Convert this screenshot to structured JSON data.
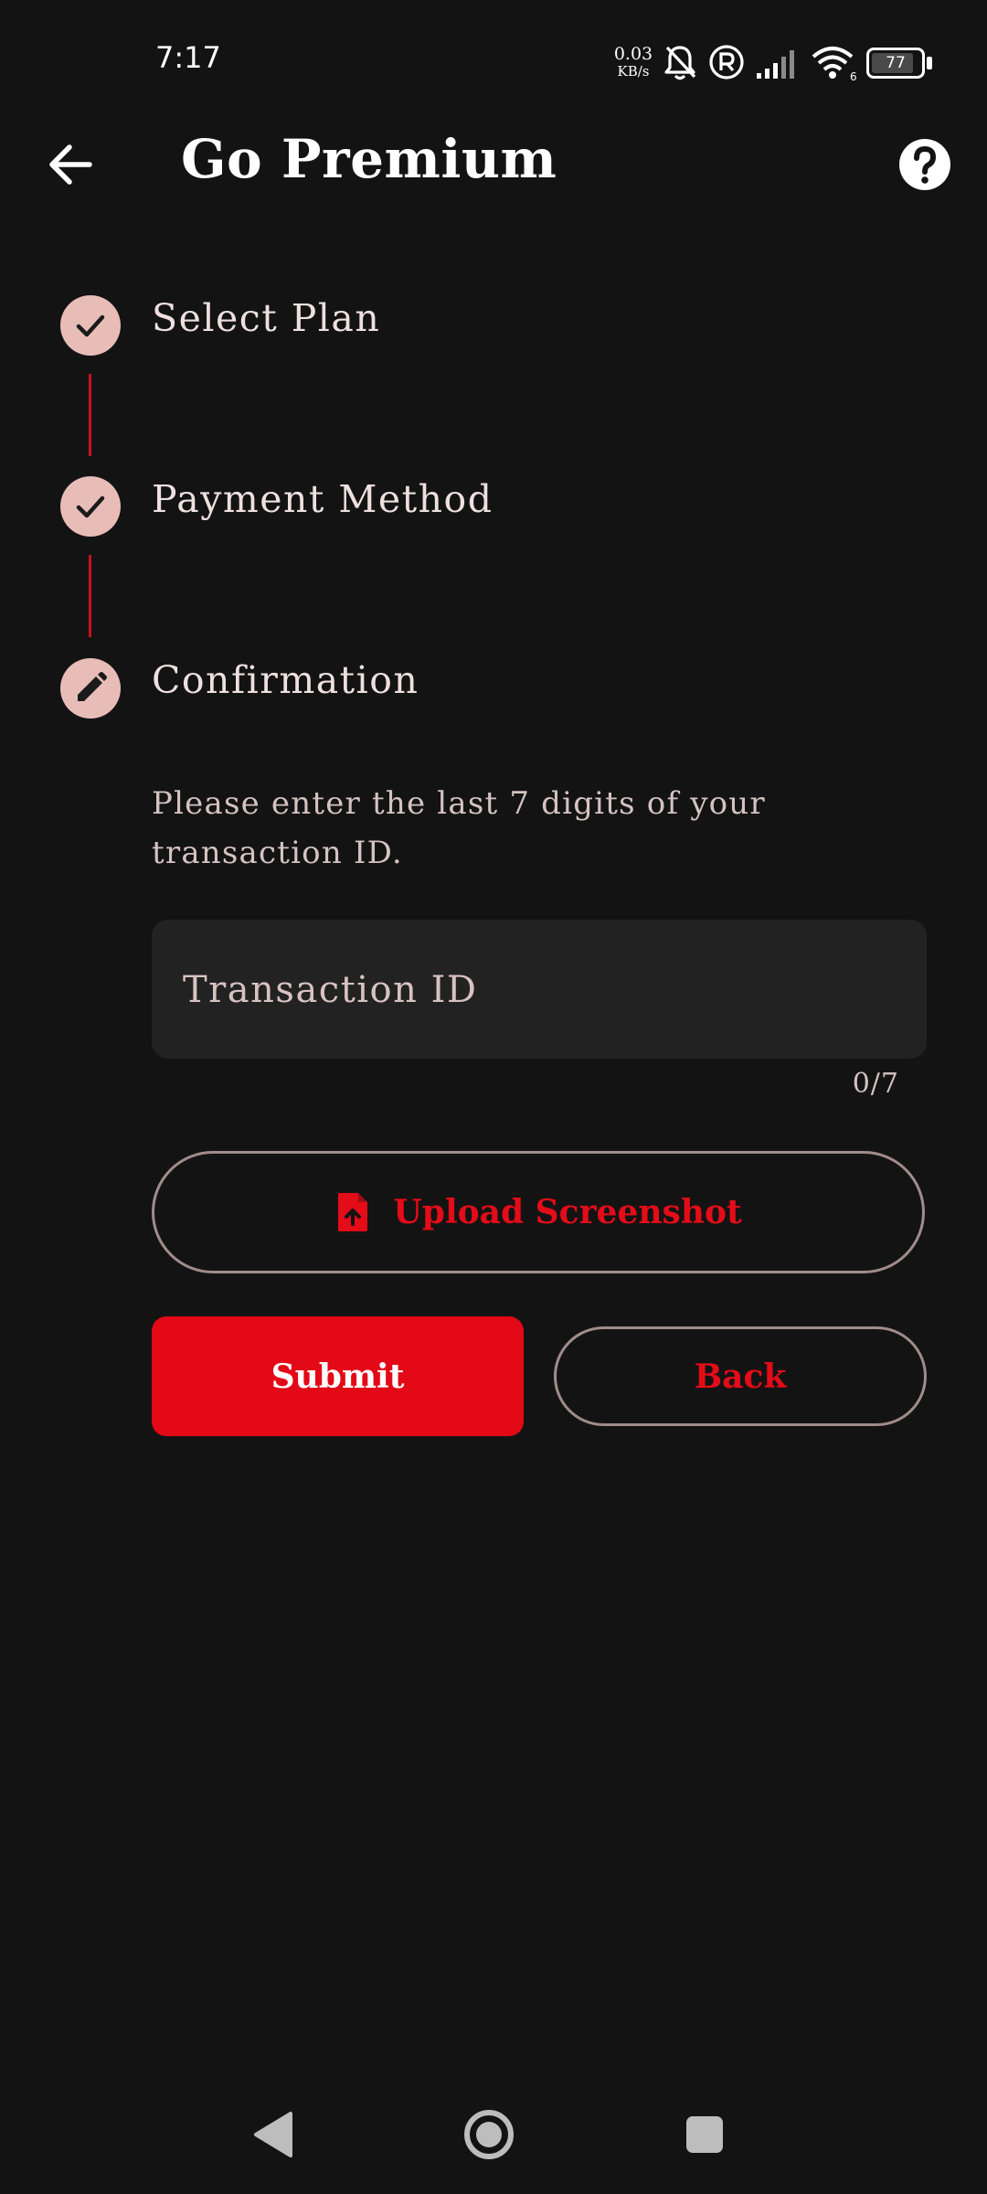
{
  "status_bar": {
    "time": "7:17",
    "net_speed_value": "0.03",
    "net_speed_unit": "KB/s",
    "battery": "77",
    "icons": [
      "bell-off-icon",
      "registered-icon",
      "signal-icon",
      "wifi-icon",
      "battery-icon"
    ]
  },
  "app_bar": {
    "title": "Go Premium",
    "back_icon": "arrow-left-icon",
    "help_icon": "help-circle-icon"
  },
  "stepper": {
    "steps": [
      {
        "label": "Select Plan",
        "state": "completed",
        "icon": "check-icon"
      },
      {
        "label": "Payment Method",
        "state": "completed",
        "icon": "check-icon"
      },
      {
        "label": "Confirmation",
        "state": "active",
        "icon": "pencil-icon"
      }
    ],
    "line_color": "#c3141f",
    "circle_color": "#e8bdb8"
  },
  "confirmation": {
    "hint": "Please enter the last 7 digits of your transaction ID.",
    "transaction_field": {
      "placeholder": "Transaction ID",
      "value": "",
      "counter": "0/7"
    },
    "upload_label": "Upload Screenshot",
    "upload_icon": "file-upload-icon",
    "submit_label": "Submit",
    "back_label": "Back"
  },
  "colors": {
    "background": "#141314",
    "accent_red": "#e30916",
    "outline": "#a08c8a"
  },
  "nav_bar": {
    "icons": [
      "nav-back-icon",
      "nav-home-icon",
      "nav-recents-icon"
    ]
  }
}
